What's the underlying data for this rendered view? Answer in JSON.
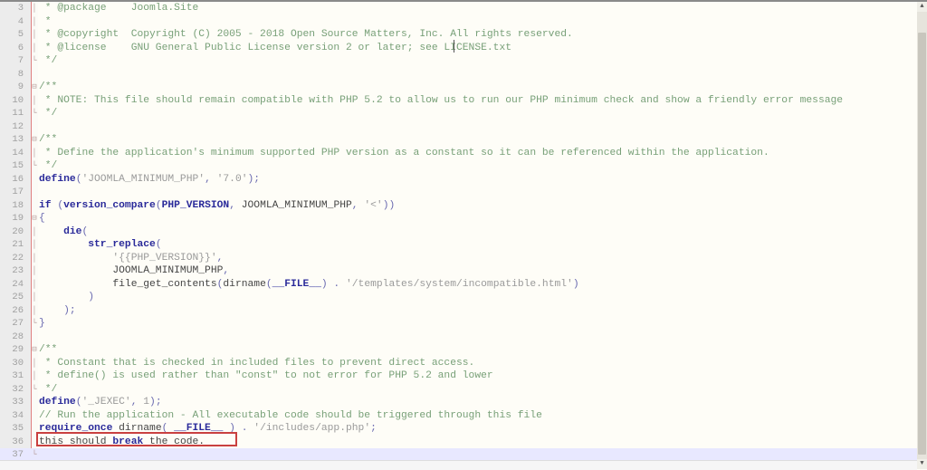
{
  "editor": {
    "lines": [
      {
        "n": "3",
        "fold": "│",
        "segs": [
          {
            "c": "cm",
            "t": " * @package    Joomla.Site"
          }
        ]
      },
      {
        "n": "4",
        "fold": "│",
        "segs": [
          {
            "c": "cm",
            "t": " *"
          }
        ]
      },
      {
        "n": "5",
        "fold": "│",
        "segs": [
          {
            "c": "cm",
            "t": " * @copyright  Copyright (C) 2005 - 2018 Open Source Matters, Inc. All rights reserved."
          }
        ]
      },
      {
        "n": "6",
        "fold": "│",
        "segs": [
          {
            "c": "cm",
            "t": " * @license    GNU General Public License version 2 or later; see LICENSE.txt"
          }
        ]
      },
      {
        "n": "7",
        "fold": "└",
        "segs": [
          {
            "c": "cm",
            "t": " */"
          }
        ]
      },
      {
        "n": "8",
        "fold": "",
        "segs": []
      },
      {
        "n": "9",
        "fold": "⊟",
        "segs": [
          {
            "c": "cm",
            "t": "/**"
          }
        ]
      },
      {
        "n": "10",
        "fold": "│",
        "segs": [
          {
            "c": "cm",
            "t": " * NOTE: This file should remain compatible with PHP 5.2 to allow us to run our PHP minimum check and show a friendly error message"
          }
        ]
      },
      {
        "n": "11",
        "fold": "└",
        "segs": [
          {
            "c": "cm",
            "t": " */"
          }
        ]
      },
      {
        "n": "12",
        "fold": "",
        "segs": []
      },
      {
        "n": "13",
        "fold": "⊟",
        "segs": [
          {
            "c": "cm",
            "t": "/**"
          }
        ]
      },
      {
        "n": "14",
        "fold": "│",
        "segs": [
          {
            "c": "cm",
            "t": " * Define the application's minimum supported PHP version as a constant so it can be referenced within the application."
          }
        ]
      },
      {
        "n": "15",
        "fold": "└",
        "segs": [
          {
            "c": "cm",
            "t": " */"
          }
        ]
      },
      {
        "n": "16",
        "fold": "",
        "segs": [
          {
            "c": "kw",
            "t": "define"
          },
          {
            "c": "op",
            "t": "("
          },
          {
            "c": "str",
            "t": "'JOOMLA_MINIMUM_PHP'"
          },
          {
            "c": "op",
            "t": ", "
          },
          {
            "c": "str",
            "t": "'7.0'"
          },
          {
            "c": "op",
            "t": ");"
          }
        ]
      },
      {
        "n": "17",
        "fold": "",
        "segs": []
      },
      {
        "n": "18",
        "fold": "",
        "segs": [
          {
            "c": "kw",
            "t": "if"
          },
          {
            "c": "plain",
            "t": " "
          },
          {
            "c": "op",
            "t": "("
          },
          {
            "c": "kw",
            "t": "version_compare"
          },
          {
            "c": "op",
            "t": "("
          },
          {
            "c": "kw",
            "t": "PHP_VERSION"
          },
          {
            "c": "op",
            "t": ", "
          },
          {
            "c": "plain",
            "t": "JOOMLA_MINIMUM_PHP"
          },
          {
            "c": "op",
            "t": ", "
          },
          {
            "c": "str",
            "t": "'<'"
          },
          {
            "c": "op",
            "t": "))"
          }
        ]
      },
      {
        "n": "19",
        "fold": "⊟",
        "segs": [
          {
            "c": "op",
            "t": "{"
          }
        ]
      },
      {
        "n": "20",
        "fold": "│",
        "segs": [
          {
            "c": "plain",
            "t": "    "
          },
          {
            "c": "kw",
            "t": "die"
          },
          {
            "c": "op",
            "t": "("
          }
        ]
      },
      {
        "n": "21",
        "fold": "│",
        "segs": [
          {
            "c": "plain",
            "t": "        "
          },
          {
            "c": "kw",
            "t": "str_replace"
          },
          {
            "c": "op",
            "t": "("
          }
        ]
      },
      {
        "n": "22",
        "fold": "│",
        "segs": [
          {
            "c": "plain",
            "t": "            "
          },
          {
            "c": "str",
            "t": "'{{PHP_VERSION}}'"
          },
          {
            "c": "op",
            "t": ","
          }
        ]
      },
      {
        "n": "23",
        "fold": "│",
        "segs": [
          {
            "c": "plain",
            "t": "            JOOMLA_MINIMUM_PHP"
          },
          {
            "c": "op",
            "t": ","
          }
        ]
      },
      {
        "n": "24",
        "fold": "│",
        "segs": [
          {
            "c": "plain",
            "t": "            file_get_contents"
          },
          {
            "c": "op",
            "t": "("
          },
          {
            "c": "plain",
            "t": "dirname"
          },
          {
            "c": "op",
            "t": "("
          },
          {
            "c": "kw",
            "t": "__FILE__"
          },
          {
            "c": "op",
            "t": ") . "
          },
          {
            "c": "str",
            "t": "'/templates/system/incompatible.html'"
          },
          {
            "c": "op",
            "t": ")"
          }
        ]
      },
      {
        "n": "25",
        "fold": "│",
        "segs": [
          {
            "c": "plain",
            "t": "        "
          },
          {
            "c": "op",
            "t": ")"
          }
        ]
      },
      {
        "n": "26",
        "fold": "│",
        "segs": [
          {
            "c": "plain",
            "t": "    "
          },
          {
            "c": "op",
            "t": ");"
          }
        ]
      },
      {
        "n": "27",
        "fold": "└",
        "segs": [
          {
            "c": "op",
            "t": "}"
          }
        ]
      },
      {
        "n": "28",
        "fold": "",
        "segs": []
      },
      {
        "n": "29",
        "fold": "⊟",
        "segs": [
          {
            "c": "cm",
            "t": "/**"
          }
        ]
      },
      {
        "n": "30",
        "fold": "│",
        "segs": [
          {
            "c": "cm",
            "t": " * Constant that is checked in included files to prevent direct access."
          }
        ]
      },
      {
        "n": "31",
        "fold": "│",
        "segs": [
          {
            "c": "cm",
            "t": " * define() is used rather than \"const\" to not error for PHP 5.2 and lower"
          }
        ]
      },
      {
        "n": "32",
        "fold": "└",
        "segs": [
          {
            "c": "cm",
            "t": " */"
          }
        ]
      },
      {
        "n": "33",
        "fold": "",
        "segs": [
          {
            "c": "kw",
            "t": "define"
          },
          {
            "c": "op",
            "t": "("
          },
          {
            "c": "str",
            "t": "'_JEXEC'"
          },
          {
            "c": "op",
            "t": ", "
          },
          {
            "c": "str",
            "t": "1"
          },
          {
            "c": "op",
            "t": ");"
          }
        ]
      },
      {
        "n": "34",
        "fold": "",
        "segs": [
          {
            "c": "cm",
            "t": "// Run the application - All executable code should be triggered through this file"
          }
        ]
      },
      {
        "n": "35",
        "fold": "",
        "segs": [
          {
            "c": "kw",
            "t": "require_once"
          },
          {
            "c": "plain",
            "t": " dirname"
          },
          {
            "c": "op",
            "t": "( "
          },
          {
            "c": "kw",
            "t": "__FILE__"
          },
          {
            "c": "op",
            "t": " ) . "
          },
          {
            "c": "str",
            "t": "'/includes/app.php'"
          },
          {
            "c": "op",
            "t": ";"
          }
        ]
      },
      {
        "n": "36",
        "fold": "",
        "segs": [
          {
            "c": "plain",
            "t": "this should "
          },
          {
            "c": "kw",
            "t": "break"
          },
          {
            "c": "plain",
            "t": " the code."
          }
        ]
      },
      {
        "n": "37",
        "fold": "└",
        "segs": [],
        "current": true
      }
    ],
    "highlight_annotation_line": "36"
  },
  "scrollbar": {
    "up_icon": "▲",
    "down_icon": "▼"
  }
}
